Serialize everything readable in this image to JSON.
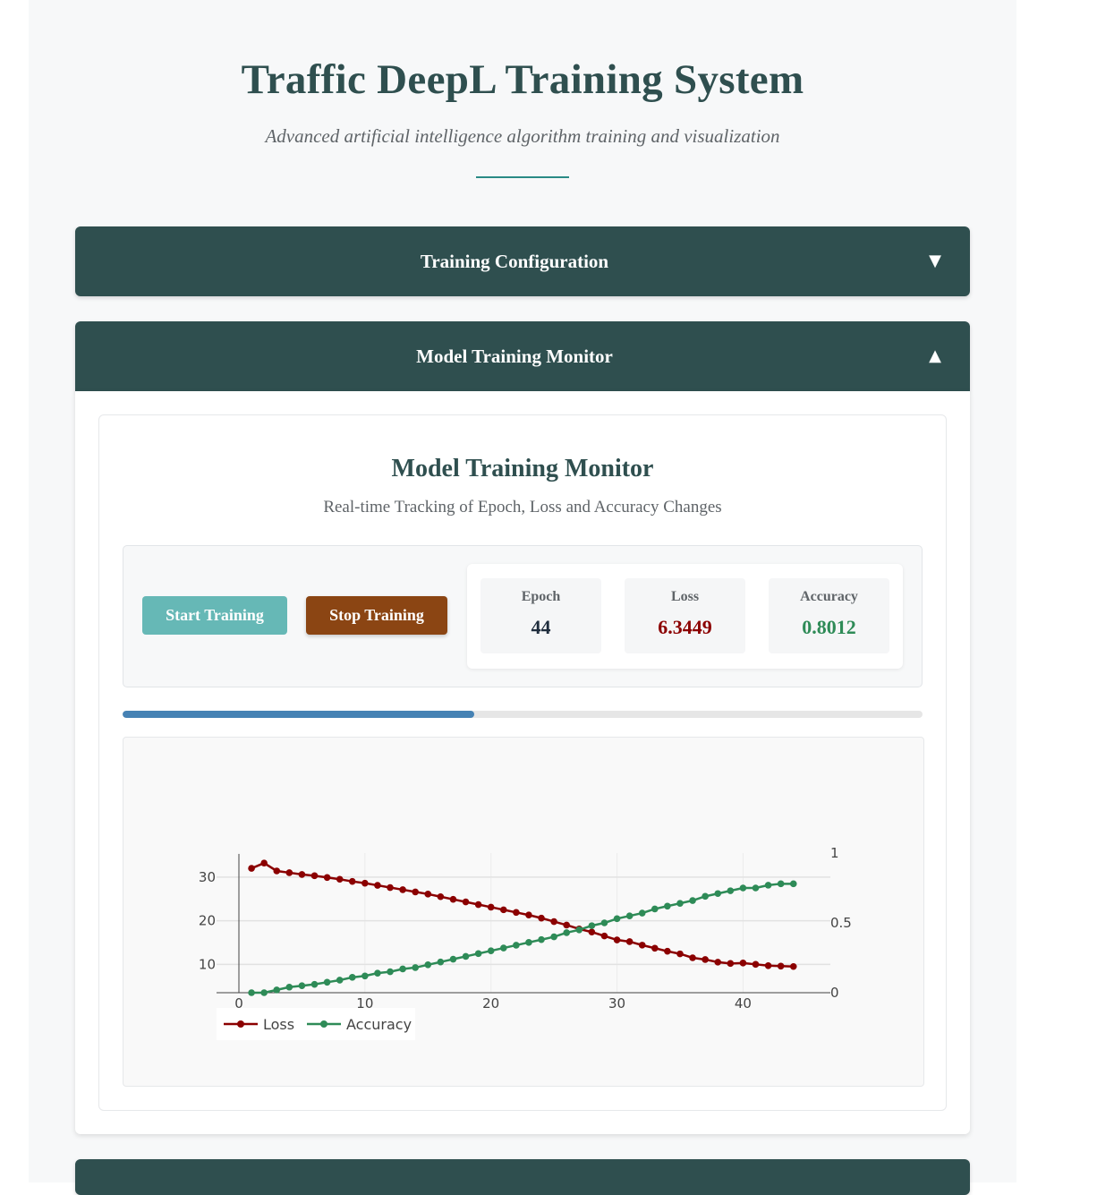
{
  "header": {
    "title": "Traffic DeepL Training System",
    "subtitle": "Advanced artificial intelligence algorithm training and visualization"
  },
  "sections": {
    "config": {
      "label": "Training Configuration",
      "toggle": "▼"
    },
    "monitor": {
      "label": "Model Training Monitor",
      "toggle": "▲"
    }
  },
  "monitor": {
    "title": "Model Training Monitor",
    "subtitle": "Real-time Tracking of Epoch, Loss and Accuracy Changes",
    "start_label": "Start Training",
    "stop_label": "Stop Training",
    "stats": {
      "epoch_label": "Epoch",
      "epoch_value": "44",
      "loss_label": "Loss",
      "loss_value": "6.3449",
      "accuracy_label": "Accuracy",
      "accuracy_value": "0.8012"
    },
    "progress_fraction": 0.44
  },
  "colors": {
    "primary": "#2f4f4f",
    "start_button": "#66b8b6",
    "stop_button": "#8b4513",
    "loss": "#8b0000",
    "accuracy": "#2e8b57",
    "progress": "#4682b4",
    "epoch_value": "#1f2d3d"
  },
  "chart_data": {
    "type": "line",
    "x": [
      1,
      2,
      3,
      4,
      5,
      6,
      7,
      8,
      9,
      10,
      11,
      12,
      13,
      14,
      15,
      16,
      17,
      18,
      19,
      20,
      21,
      22,
      23,
      24,
      25,
      26,
      27,
      28,
      29,
      30,
      31,
      32,
      33,
      34,
      35,
      36,
      37,
      38,
      39,
      40,
      41,
      42,
      43,
      44
    ],
    "series": [
      {
        "name": "Loss",
        "axis": "left",
        "values": [
          32.0,
          33.2,
          31.4,
          31.0,
          30.6,
          30.3,
          29.9,
          29.5,
          29.0,
          28.6,
          28.1,
          27.6,
          27.1,
          26.6,
          26.1,
          25.5,
          24.9,
          24.3,
          23.7,
          23.1,
          22.5,
          21.9,
          21.3,
          20.6,
          19.8,
          19.0,
          18.1,
          17.4,
          16.5,
          15.6,
          15.2,
          14.4,
          13.7,
          13.0,
          12.4,
          11.5,
          11.1,
          10.5,
          10.2,
          10.3,
          10.0,
          9.7,
          9.6,
          9.5
        ]
      },
      {
        "name": "Accuracy",
        "axis": "right",
        "values": [
          0.0,
          0.0,
          0.02,
          0.04,
          0.05,
          0.06,
          0.075,
          0.09,
          0.11,
          0.12,
          0.14,
          0.15,
          0.17,
          0.18,
          0.2,
          0.22,
          0.24,
          0.26,
          0.28,
          0.3,
          0.32,
          0.34,
          0.36,
          0.38,
          0.4,
          0.43,
          0.45,
          0.48,
          0.5,
          0.53,
          0.55,
          0.57,
          0.6,
          0.62,
          0.64,
          0.66,
          0.69,
          0.71,
          0.73,
          0.75,
          0.75,
          0.77,
          0.78,
          0.78
        ]
      }
    ],
    "x_ticks": [
      0,
      10,
      20,
      30,
      40
    ],
    "y_left_ticks": [
      10,
      20,
      30
    ],
    "y_left_range": [
      3.5,
      35.5
    ],
    "y_right_ticks": [
      0,
      0.5,
      1
    ],
    "y_right_range": [
      0,
      1
    ],
    "x_range": [
      0,
      47
    ],
    "legend": "bottom-left",
    "grid": true
  }
}
